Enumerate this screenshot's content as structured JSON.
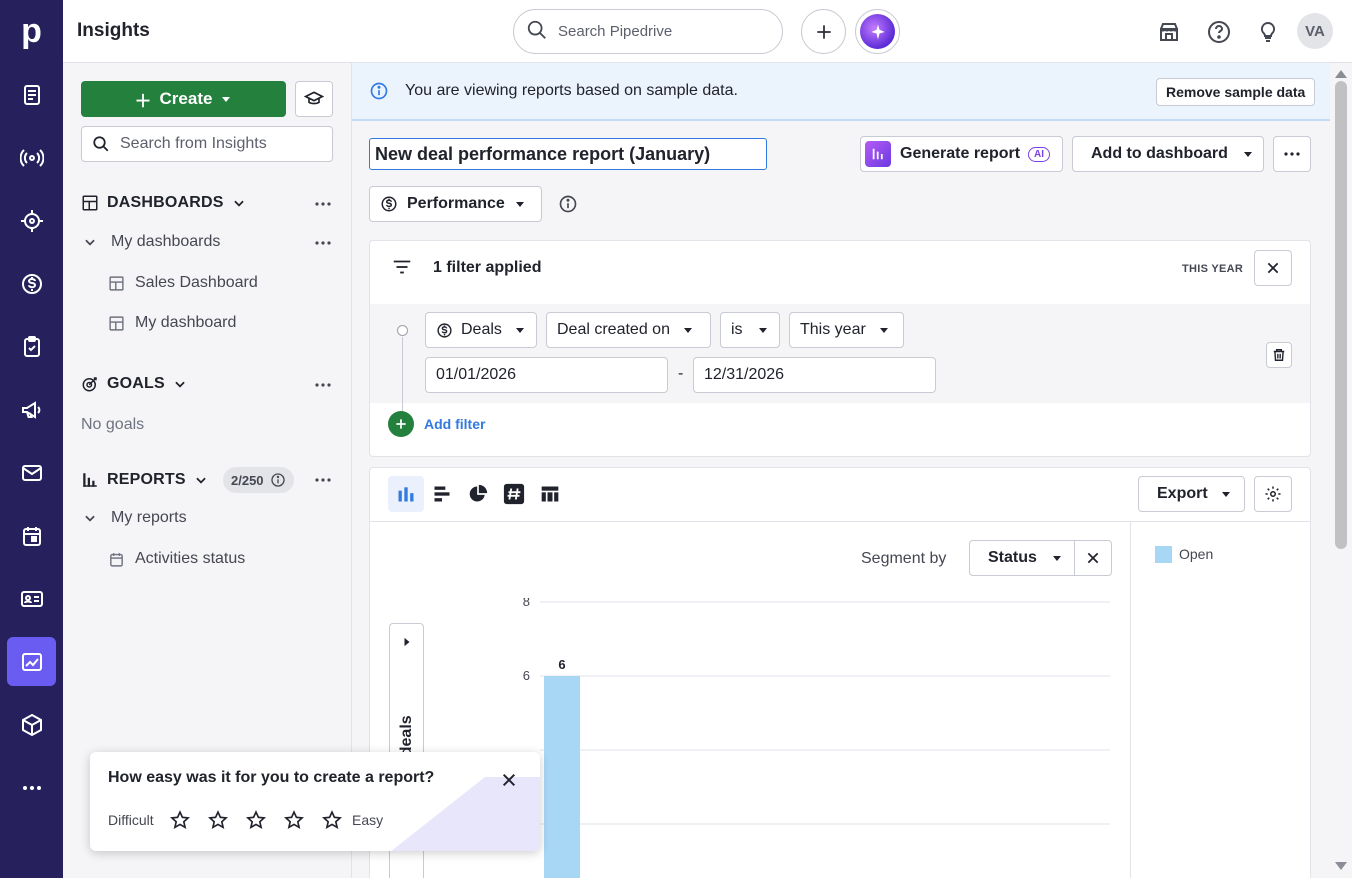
{
  "app": {
    "logo": "p",
    "title": "Insights"
  },
  "topbar": {
    "search_placeholder": "Search Pipedrive",
    "avatar_initials": "VA"
  },
  "rail": {
    "items": [
      "deals-list-icon",
      "leads-icon",
      "projects-target-icon",
      "deals-dollar-icon",
      "activities-clipboard-icon",
      "campaigns-megaphone-icon",
      "mail-icon",
      "calendar-icon",
      "contacts-card-icon",
      "insights-chart-icon",
      "products-box-icon",
      "more-icon"
    ],
    "active_index": 9
  },
  "sidebar": {
    "create_label": "Create",
    "search_placeholder": "Search from Insights",
    "dashboards": {
      "heading": "DASHBOARDS",
      "group": "My dashboards",
      "items": [
        "Sales Dashboard",
        "My dashboard"
      ]
    },
    "goals": {
      "heading": "GOALS",
      "empty": "No goals"
    },
    "reports": {
      "heading": "REPORTS",
      "count": "2/250",
      "group": "My reports",
      "items": [
        "Activities status"
      ]
    }
  },
  "banner": {
    "text": "You are viewing reports based on sample data.",
    "remove_label": "Remove sample data"
  },
  "report": {
    "title": "New deal performance report (January)",
    "generate_label": "Generate report",
    "ai_badge": "AI",
    "add_dashboard_label": "Add to dashboard",
    "type_label": "Performance"
  },
  "filters": {
    "summary": "1 filter applied",
    "period_tag": "THIS YEAR",
    "entity": "Deals",
    "field": "Deal created on",
    "operator": "is",
    "value": "This year",
    "from": "01/01/2026",
    "separator": "-",
    "to": "12/31/2026",
    "add_label": "Add filter"
  },
  "chart_panel": {
    "export_label": "Export",
    "segment_label": "Segment by",
    "segment_value": "Status",
    "legend": [
      {
        "label": "Open",
        "color": "#a8d6f5"
      }
    ]
  },
  "chart_data": {
    "type": "bar",
    "ylabel": "Number of deals",
    "yticks": [
      6,
      8
    ],
    "series": [
      {
        "name": "Open",
        "values": [
          6
        ],
        "color": "#a8d6f5"
      }
    ],
    "data_labels": [
      "6"
    ]
  },
  "survey": {
    "question": "How easy was it for you to create a report?",
    "low_label": "Difficult",
    "high_label": "Easy",
    "stars": 5
  }
}
